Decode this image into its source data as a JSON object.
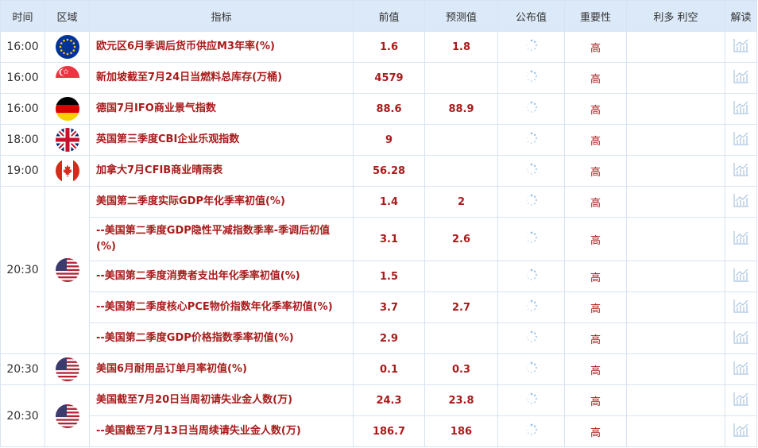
{
  "headers": {
    "time": "时间",
    "region": "区域",
    "indicator": "指标",
    "previous": "前值",
    "forecast": "预测值",
    "actual": "公布值",
    "importance": "重要性",
    "impact": "利多 利空",
    "interpret": "解读"
  },
  "rows": [
    {
      "time": "16:00",
      "flag": "eu-flag",
      "indicator": "欧元区6月季调后货币供应M3年率(%)",
      "previous": "1.6",
      "forecast": "1.8",
      "importance": "高"
    },
    {
      "time": "16:00",
      "flag": "singapore-flag",
      "indicator": "新加坡截至7月24日当燃料总库存(万桶)",
      "previous": "4579",
      "forecast": "",
      "importance": "高"
    },
    {
      "time": "16:00",
      "flag": "germany-flag",
      "indicator": "德国7月IFO商业景气指数",
      "previous": "88.6",
      "forecast": "88.9",
      "importance": "高"
    },
    {
      "time": "18:00",
      "flag": "uk-flag",
      "indicator": "英国第三季度CBI企业乐观指数",
      "previous": "9",
      "forecast": "",
      "importance": "高"
    },
    {
      "time": "19:00",
      "flag": "canada-flag",
      "indicator": "加拿大7月CFIB商业晴雨表",
      "previous": "56.28",
      "forecast": "",
      "importance": "高"
    },
    {
      "time": "20:30",
      "flag": "us-flag",
      "indicator": "美国第二季度实际GDP年化季率初值(%)",
      "previous": "1.4",
      "forecast": "2",
      "importance": "高"
    },
    {
      "time": "",
      "flag": "",
      "indicator": "--美国第二季度GDP隐性平减指数季率-季调后初值(%)",
      "previous": "3.1",
      "forecast": "2.6",
      "importance": "高"
    },
    {
      "time": "",
      "flag": "",
      "indicator": "--美国第二季度消费者支出年化季率初值(%)",
      "previous": "1.5",
      "forecast": "",
      "importance": "高"
    },
    {
      "time": "",
      "flag": "",
      "indicator": "--美国第二季度核心PCE物价指数年化季率初值(%)",
      "previous": "3.7",
      "forecast": "2.7",
      "importance": "高"
    },
    {
      "time": "",
      "flag": "",
      "indicator": "--美国第二季度GDP价格指数季率初值(%)",
      "previous": "2.9",
      "forecast": "",
      "importance": "高"
    },
    {
      "time": "20:30",
      "flag": "us-flag",
      "indicator": "美国6月耐用品订单月率初值(%)",
      "previous": "0.1",
      "forecast": "0.3",
      "importance": "高"
    },
    {
      "time": "20:30",
      "flag": "us-flag",
      "indicator": "美国截至7月20日当周初请失业金人数(万)",
      "previous": "24.3",
      "forecast": "23.8",
      "importance": "高"
    },
    {
      "time": "",
      "flag": "",
      "indicator": "--美国截至7月13日当周续请失业金人数(万)",
      "previous": "186.7",
      "forecast": "186",
      "importance": "高"
    }
  ]
}
